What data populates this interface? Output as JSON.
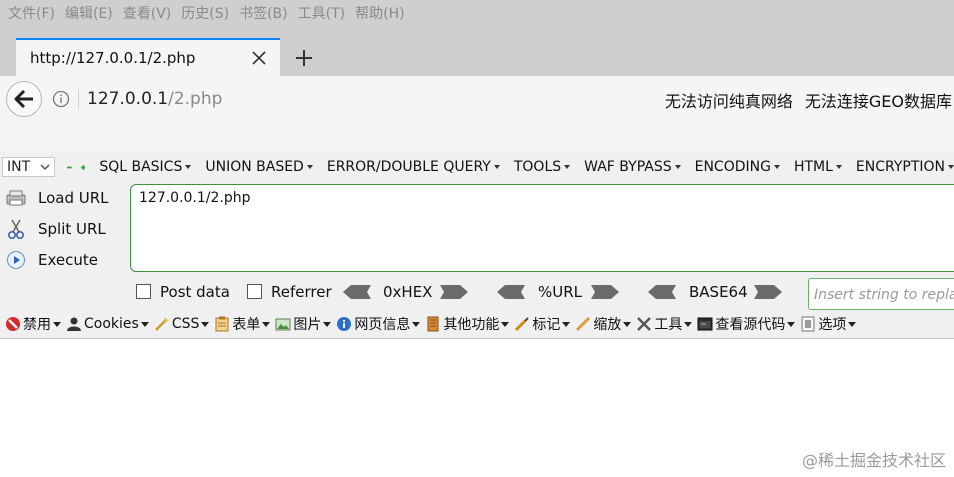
{
  "menubar": {
    "items": [
      "文件(F)",
      "编辑(E)",
      "查看(V)",
      "历史(S)",
      "书签(B)",
      "工具(T)",
      "帮助(H)"
    ]
  },
  "tab": {
    "title": "http://127.0.0.1/2.php"
  },
  "navbar": {
    "url_host": "127.0.0.1",
    "url_path": "/2.php",
    "status1": "无法访问纯真网络",
    "status2": "无法连接GEO数据库"
  },
  "hackbar": {
    "select_value": "INT",
    "menus": [
      "SQL BASICS",
      "UNION BASED",
      "ERROR/DOUBLE QUERY",
      "TOOLS",
      "WAF BYPASS",
      "ENCODING",
      "HTML",
      "ENCRYPTION"
    ],
    "actions": [
      "Load URL",
      "Split URL",
      "Execute"
    ],
    "url_text": "127.0.0.1/2.php",
    "post_data_label": "Post data",
    "referrer_label": "Referrer",
    "hex_label": "0xHEX",
    "url_label": "%URL",
    "base64_label": "BASE64",
    "replace_placeholder": "Insert string to replace"
  },
  "webdev": {
    "items": [
      {
        "label": "禁用",
        "icon": "disable-icon"
      },
      {
        "label": "Cookies",
        "icon": "cookies-icon"
      },
      {
        "label": "CSS",
        "icon": "css-icon"
      },
      {
        "label": "表单",
        "icon": "form-icon"
      },
      {
        "label": "图片",
        "icon": "image-icon"
      },
      {
        "label": "网页信息",
        "icon": "info-icon"
      },
      {
        "label": "其他功能",
        "icon": "misc-icon"
      },
      {
        "label": "标记",
        "icon": "outline-icon"
      },
      {
        "label": "缩放",
        "icon": "resize-icon"
      },
      {
        "label": "工具",
        "icon": "tools-icon"
      },
      {
        "label": "查看源代码",
        "icon": "source-icon"
      },
      {
        "label": "选项",
        "icon": "options-icon"
      }
    ]
  },
  "watermark": "@稀土掘金技术社区"
}
